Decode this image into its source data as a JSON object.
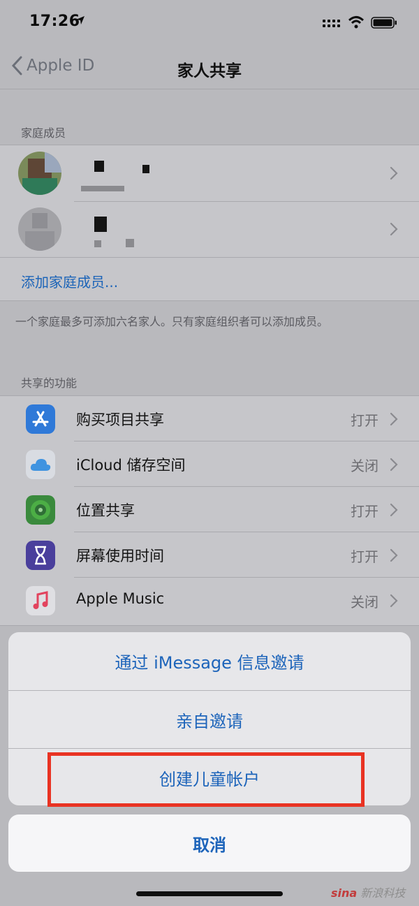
{
  "status_bar": {
    "time": "17:26"
  },
  "nav": {
    "back_label": "Apple ID",
    "title": "家人共享"
  },
  "family_section": {
    "header": "家庭成员",
    "add_member": "添加家庭成员...",
    "footnote": "一个家庭最多可添加六名家人。只有家庭组织者可以添加成员。"
  },
  "features_section": {
    "header": "共享的功能",
    "items": [
      {
        "label": "购买项目共享",
        "value": "打开",
        "icon": "app-store-icon"
      },
      {
        "label": "iCloud 储存空间",
        "value": "关闭",
        "icon": "icloud-icon"
      },
      {
        "label": "位置共享",
        "value": "打开",
        "icon": "find-my-icon"
      },
      {
        "label": "屏幕使用时间",
        "value": "打开",
        "icon": "screen-time-icon"
      },
      {
        "label": "Apple Music",
        "value": "关闭",
        "icon": "music-icon"
      }
    ]
  },
  "action_sheet": {
    "items": [
      "通过 iMessage 信息邀请",
      "亲自邀请",
      "创建儿童帐户"
    ],
    "cancel": "取消"
  },
  "watermark": {
    "brand": "sina",
    "text": "新浪科技"
  },
  "colors": {
    "link_blue": "#1d64ba",
    "highlight_red": "#e93323"
  }
}
